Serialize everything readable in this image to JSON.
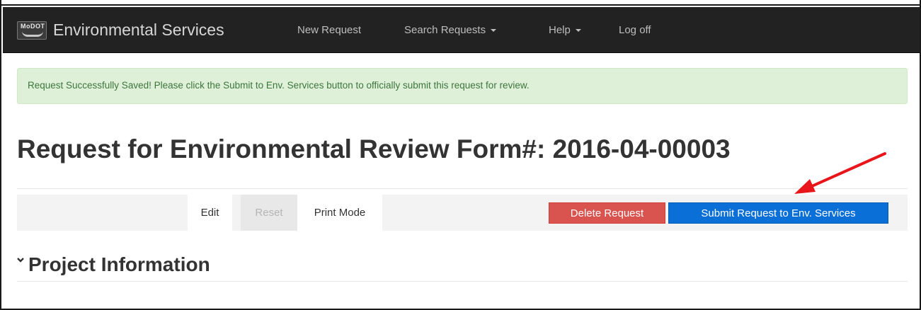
{
  "navbar": {
    "logo_text": "MoDOT",
    "brand": "Environmental Services",
    "items": [
      {
        "label": "New Request",
        "has_caret": false
      },
      {
        "label": "Search Requests",
        "has_caret": true
      },
      {
        "label": "Help",
        "has_caret": true
      },
      {
        "label": "Log off",
        "has_caret": false
      }
    ]
  },
  "alert": {
    "message": "Request Successfully Saved! Please click the Submit to Env. Services button to officially submit this request for review."
  },
  "page": {
    "title": "Request for Environmental Review Form#: 2016-04-00003"
  },
  "toolbar": {
    "edit_label": "Edit",
    "reset_label": "Reset",
    "print_label": "Print Mode",
    "delete_label": "Delete Request",
    "submit_label": "Submit Request to Env. Services"
  },
  "section": {
    "heading": "Project Information",
    "icon": "chevron-down-icon"
  },
  "colors": {
    "navbar_bg": "#222222",
    "alert_bg": "#dff0d8",
    "alert_text": "#3c763d",
    "delete_bg": "#d9534f",
    "submit_bg": "#0a6fd6",
    "annotation_arrow": "#e8161a"
  }
}
